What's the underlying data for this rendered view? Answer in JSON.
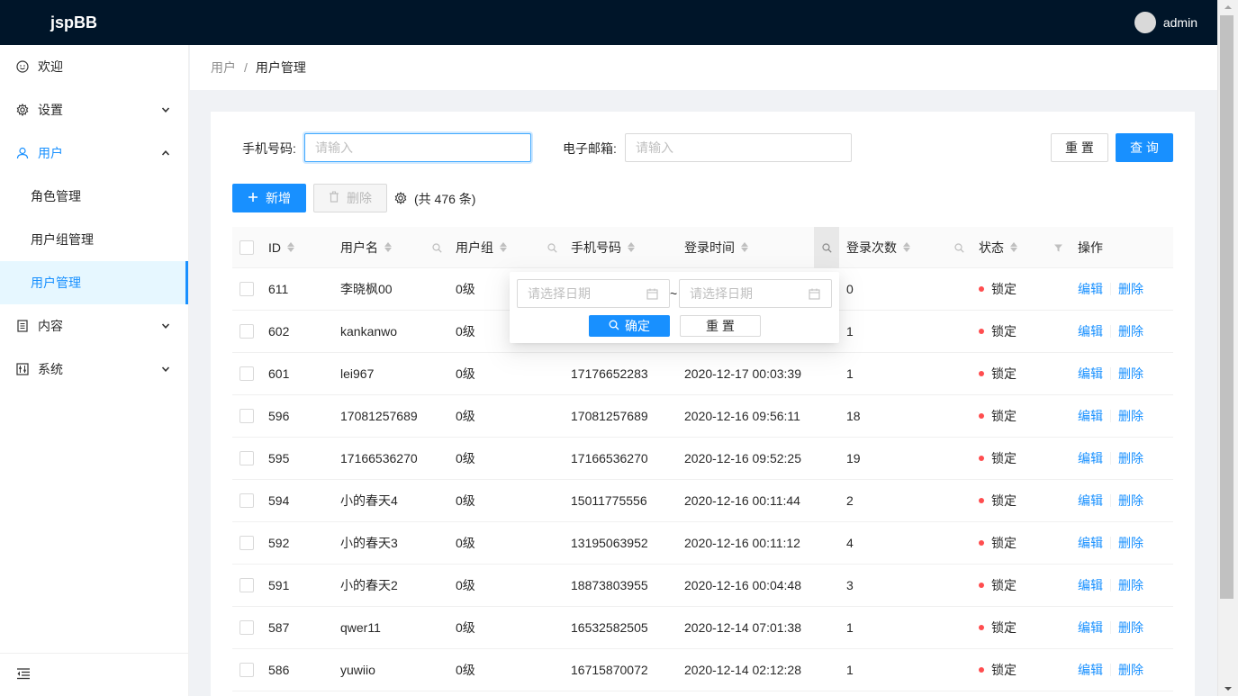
{
  "app": {
    "title": "jspBB",
    "username": "admin"
  },
  "sidebar": {
    "items": [
      {
        "label": "欢迎",
        "icon": "smile-icon"
      },
      {
        "label": "设置",
        "icon": "setting-icon"
      },
      {
        "label": "用户",
        "icon": "user-icon"
      },
      {
        "label": "内容",
        "icon": "file-icon"
      },
      {
        "label": "系统",
        "icon": "control-icon"
      }
    ],
    "user_submenu": [
      "角色管理",
      "用户组管理",
      "用户管理"
    ]
  },
  "breadcrumb": {
    "parent": "用户",
    "separator": "/",
    "current": "用户管理"
  },
  "filters": {
    "phone_label": "手机号码:",
    "phone_placeholder": "请输入",
    "email_label": "电子邮箱:",
    "email_placeholder": "请输入",
    "reset_label": "重 置",
    "search_label": "查 询"
  },
  "toolbar": {
    "add_label": "新增",
    "delete_label": "删除",
    "total_text": "(共 476 条)"
  },
  "table": {
    "columns": [
      "ID",
      "用户名",
      "用户组",
      "手机号码",
      "登录时间",
      "登录次数",
      "状态",
      "操作"
    ],
    "action_edit": "编辑",
    "action_delete": "删除",
    "rows": [
      {
        "id": "611",
        "username": "李晓枫00",
        "group": "0级",
        "phone": "",
        "login_time": "",
        "count": "0",
        "status": "锁定"
      },
      {
        "id": "602",
        "username": "kankanwo",
        "group": "0级",
        "phone": "",
        "login_time": "",
        "count": "1",
        "status": "锁定"
      },
      {
        "id": "601",
        "username": "lei967",
        "group": "0级",
        "phone": "17176652283",
        "login_time": "2020-12-17 00:03:39",
        "count": "1",
        "status": "锁定"
      },
      {
        "id": "596",
        "username": "17081257689",
        "group": "0级",
        "phone": "17081257689",
        "login_time": "2020-12-16 09:56:11",
        "count": "18",
        "status": "锁定"
      },
      {
        "id": "595",
        "username": "17166536270",
        "group": "0级",
        "phone": "17166536270",
        "login_time": "2020-12-16 09:52:25",
        "count": "19",
        "status": "锁定"
      },
      {
        "id": "594",
        "username": "小的春天4",
        "group": "0级",
        "phone": "15011775556",
        "login_time": "2020-12-16 00:11:44",
        "count": "2",
        "status": "锁定"
      },
      {
        "id": "592",
        "username": "小的春天3",
        "group": "0级",
        "phone": "13195063952",
        "login_time": "2020-12-16 00:11:12",
        "count": "4",
        "status": "锁定"
      },
      {
        "id": "591",
        "username": "小的春天2",
        "group": "0级",
        "phone": "18873803955",
        "login_time": "2020-12-16 00:04:48",
        "count": "3",
        "status": "锁定"
      },
      {
        "id": "587",
        "username": "qwer11",
        "group": "0级",
        "phone": "16532582505",
        "login_time": "2020-12-14 07:01:38",
        "count": "1",
        "status": "锁定"
      },
      {
        "id": "586",
        "username": "yuwiio",
        "group": "0级",
        "phone": "16715870072",
        "login_time": "2020-12-14 02:12:28",
        "count": "1",
        "status": "锁定"
      }
    ]
  },
  "date_filter": {
    "start_placeholder": "请选择日期",
    "end_placeholder": "请选择日期",
    "separator": "~",
    "confirm_label": "确定",
    "reset_label": "重 置"
  },
  "colors": {
    "primary": "#1890ff",
    "header_bg": "#001529",
    "status_locked": "#ff4d4f"
  }
}
